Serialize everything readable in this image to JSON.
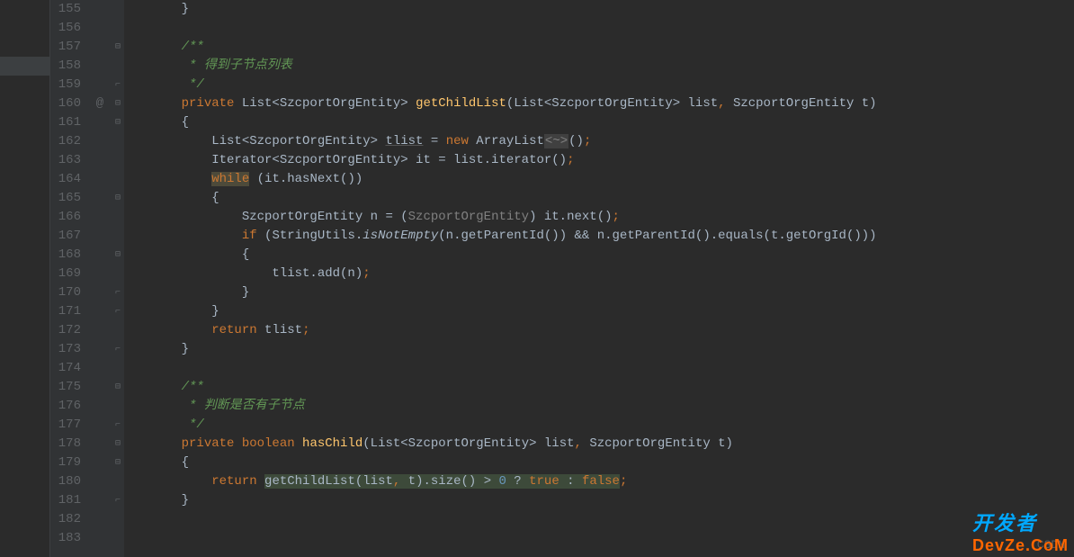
{
  "gutter": {
    "start": 155,
    "end": 183,
    "annotations": {
      "160": "@"
    },
    "folds": {
      "157": "minus",
      "159": "close",
      "160": "open",
      "161": "minus",
      "165": "minus",
      "168": "minus",
      "170": "close",
      "171": "close",
      "172": "",
      "173": "close",
      "175": "minus",
      "177": "close",
      "178": "open",
      "179": "minus",
      "181": "close"
    }
  },
  "code": {
    "l155": "    }",
    "l156": "",
    "l157_1": "    ",
    "l157_2": "/**",
    "l158_1": "     * ",
    "l158_2": "得到子节点列表",
    "l159": "     */",
    "l160_private": "private",
    "l160_list": " List<SzcportOrgEntity> ",
    "l160_method": "getChildList",
    "l160_params": "(List<SzcportOrgEntity> list",
    "l160_comma": ",",
    "l160_params2": " SzcportOrgEntity t)",
    "l161": "    {",
    "l162_a": "        List<SzcportOrgEntity> ",
    "l162_var": "tlist",
    "l162_b": " = ",
    "l162_new": "new",
    "l162_c": " ArrayList",
    "l162_d": "<~>",
    "l162_e": "()",
    "l162_semi": ";",
    "l163_a": "        Iterator<SzcportOrgEntity> it = list.iterator()",
    "l163_semi": ";",
    "l164_a": "        ",
    "l164_while": "while",
    "l164_b": " (it.hasNext())",
    "l165": "        {",
    "l166_a": "            SzcportOrgEntity n = (",
    "l166_cast": "SzcportOrgEntity",
    "l166_b": ") it.next()",
    "l166_semi": ";",
    "l167_a": "            ",
    "l167_if": "if",
    "l167_b": " (StringUtils.",
    "l167_m": "isNotEmpty",
    "l167_c": "(n.getParentId()) && n.getParentId().equals(t.getOrgId()))",
    "l168": "            {",
    "l169_a": "                tlist.add(n)",
    "l169_semi": ";",
    "l170": "            }",
    "l171": "        }",
    "l172_a": "        ",
    "l172_ret": "return",
    "l172_b": " tlist",
    "l172_semi": ";",
    "l173": "    }",
    "l174": "",
    "l175_1": "    ",
    "l175_2": "/**",
    "l176_1": "     * ",
    "l176_2": "判断是否有子节点",
    "l177": "     */",
    "l178_private": "private",
    "l178_bool": " boolean ",
    "l178_method": "hasChild",
    "l178_params": "(List<SzcportOrgEntity> list",
    "l178_comma": ",",
    "l178_params2": " SzcportOrgEntity t)",
    "l179": "    {",
    "l180_a": "        ",
    "l180_ret": "return",
    "l180_sp": " ",
    "l180_call": "getChildList(list",
    "l180_c1": ",",
    "l180_call2": " t).size() > ",
    "l180_num": "0",
    "l180_q": " ? ",
    "l180_true": "true",
    "l180_col": " : ",
    "l180_false": "false",
    "l180_semi": ";",
    "l181": "    }",
    "l182": "",
    "l183": ""
  },
  "watermark": "CSDN",
  "devze_top": "开发者",
  "devze_bottom": "DevZe.CoM"
}
